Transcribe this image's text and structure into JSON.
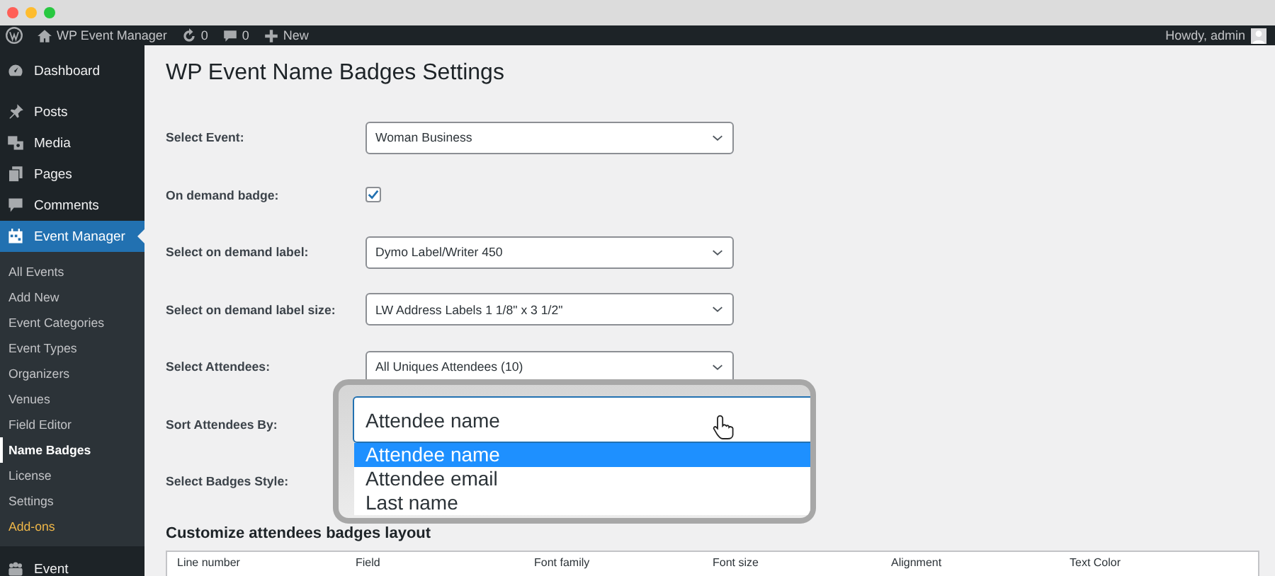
{
  "admin_bar": {
    "site": "WP Event Manager",
    "updates": "0",
    "comments": "0",
    "new": "New",
    "greeting": "Howdy, admin"
  },
  "sidebar": {
    "items": [
      {
        "label": "Dashboard",
        "kind": "main",
        "selected": false
      },
      {
        "label": "Posts",
        "kind": "main",
        "selected": false
      },
      {
        "label": "Media",
        "kind": "main",
        "selected": false
      },
      {
        "label": "Pages",
        "kind": "main",
        "selected": false
      },
      {
        "label": "Comments",
        "kind": "main",
        "selected": false
      },
      {
        "label": "Event Manager",
        "kind": "main",
        "selected": true,
        "children": [
          {
            "label": "All Events",
            "kind": "sub",
            "selected": false
          },
          {
            "label": "Add New",
            "kind": "sub",
            "selected": false
          },
          {
            "label": "Event Categories",
            "kind": "sub",
            "selected": false
          },
          {
            "label": "Event Types",
            "kind": "sub",
            "selected": false
          },
          {
            "label": "Organizers",
            "kind": "sub",
            "selected": false
          },
          {
            "label": "Venues",
            "kind": "sub",
            "selected": false
          },
          {
            "label": "Field Editor",
            "kind": "sub",
            "selected": false
          },
          {
            "label": "Name Badges",
            "kind": "sub",
            "selected": true
          },
          {
            "label": "License",
            "kind": "sub",
            "selected": false
          },
          {
            "label": "Settings",
            "kind": "sub",
            "selected": false
          },
          {
            "label": "Add-ons",
            "kind": "promo",
            "selected": false
          }
        ]
      },
      {
        "label": "Event",
        "kind": "main",
        "selected": false
      }
    ]
  },
  "page": {
    "title": "WP Event Name Badges Settings",
    "fields": [
      {
        "label": "Select Event:",
        "kind": "select",
        "value": "Woman Business"
      },
      {
        "label": "On demand badge:",
        "kind": "checkbox",
        "checked": true
      },
      {
        "label": "Select on demand label:",
        "kind": "select",
        "value": "Dymo Label/Writer 450"
      },
      {
        "label": "Select on demand label size:",
        "kind": "select",
        "value": "LW Address Labels 1 1/8\" x 3 1/2\""
      },
      {
        "label": "Select Attendees:",
        "kind": "select",
        "value": "All Uniques Attendees (10)"
      },
      {
        "label": "Sort Attendees By:",
        "kind": "covered"
      },
      {
        "label": "Select Badges Style:",
        "kind": "covered"
      }
    ],
    "zoom_popup": {
      "value": "Attendee name",
      "options": [
        {
          "label": "Attendee name",
          "selected": true
        },
        {
          "label": "Attendee email",
          "selected": false
        },
        {
          "label": "Last name",
          "selected": false
        }
      ]
    },
    "section_heading": "Customize attendees badges layout",
    "table": {
      "columns": [
        "Line number",
        "Field",
        "Font family",
        "Font size",
        "Alignment",
        "Text Color"
      ]
    }
  }
}
